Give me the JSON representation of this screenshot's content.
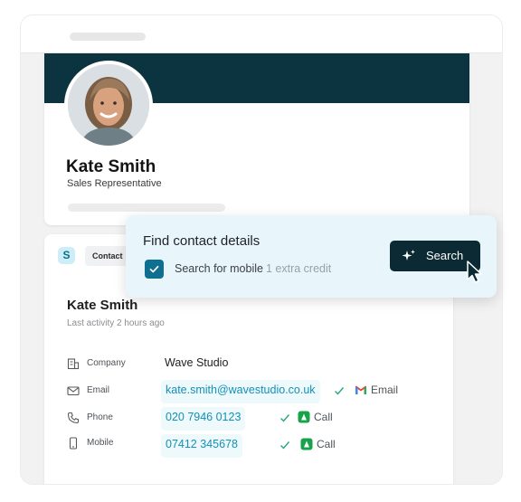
{
  "profile": {
    "name": "Kate Smith",
    "role": "Sales Representative"
  },
  "contact_panel": {
    "logo_letter": "S",
    "tab_label": "Contact",
    "name": "Kate Smith",
    "last_activity": "Last activity 2 hours ago",
    "rows": [
      {
        "icon": "building-icon",
        "label": "Company",
        "value": "Wave Studio"
      },
      {
        "icon": "mail-icon",
        "label": "Email",
        "value": "kate.smith@wavestudio.co.uk",
        "action_icon": "gmail-icon",
        "action_label": "Email"
      },
      {
        "icon": "phone-icon",
        "label": "Phone",
        "value": "020 7946 0123",
        "action_icon": "call-app-icon",
        "action_label": "Call"
      },
      {
        "icon": "mobile-icon",
        "label": "Mobile",
        "value": "07412 345678",
        "action_icon": "call-app-icon",
        "action_label": "Call"
      }
    ]
  },
  "popup": {
    "title": "Find contact details",
    "option_label": "Search for mobile",
    "option_credit": "1 extra credit",
    "option_checked": true,
    "search_button": "Search"
  },
  "colors": {
    "banner": "#0b3440",
    "link": "#1390b6",
    "popup_bg": "#e8f6fb",
    "checkbox": "#0f6f91",
    "search_button": "#0b2a33",
    "verified_check": "#2ba385",
    "call_app": "#16a34a"
  }
}
